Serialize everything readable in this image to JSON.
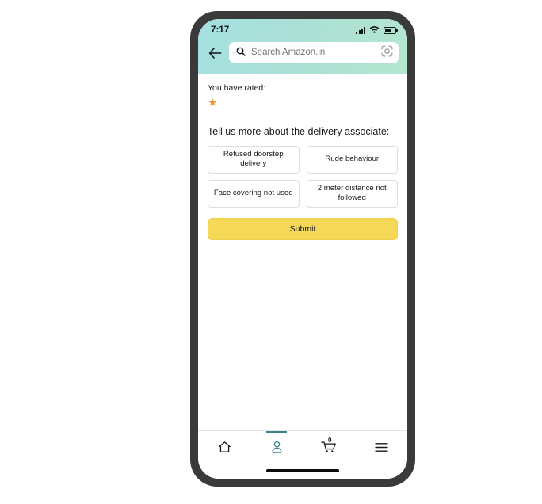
{
  "device": {
    "frame_color": "#3a3a3a",
    "screen_bg": "#ffffff"
  },
  "status_bar": {
    "time": "7:17",
    "signal_icon": "signal-bars-icon",
    "wifi_icon": "wifi-icon",
    "battery_icon": "battery-icon"
  },
  "header": {
    "gradient_from": "#a5e0e0",
    "gradient_to": "#b4e6cf",
    "back_icon": "back-arrow-icon",
    "search": {
      "placeholder": "Search Amazon.in",
      "value": "",
      "search_icon": "search-icon",
      "camera_icon": "camera-scan-icon"
    }
  },
  "rating": {
    "label": "You have rated:",
    "value": 1,
    "max": 5,
    "filled_star": "★",
    "empty_star": "☆",
    "star_color": "#e8983f"
  },
  "feedback": {
    "title": "Tell us more about the delivery associate:",
    "options": [
      {
        "label": "Refused doorstep delivery",
        "selected": false
      },
      {
        "label": "Rude behaviour",
        "selected": false
      },
      {
        "label": "Face covering not used",
        "selected": false
      },
      {
        "label": "2 meter distance not followed",
        "selected": false
      }
    ],
    "submit_label": "Submit",
    "submit_color": "#f6d859"
  },
  "bottom_nav": {
    "active_color": "#3d7f8c",
    "items": [
      {
        "name": "home",
        "icon": "home-icon",
        "active": false
      },
      {
        "name": "account",
        "icon": "person-icon",
        "active": true
      },
      {
        "name": "cart",
        "icon": "cart-icon",
        "active": false,
        "badge": "0"
      },
      {
        "name": "menu",
        "icon": "hamburger-menu-icon",
        "active": false
      }
    ]
  }
}
